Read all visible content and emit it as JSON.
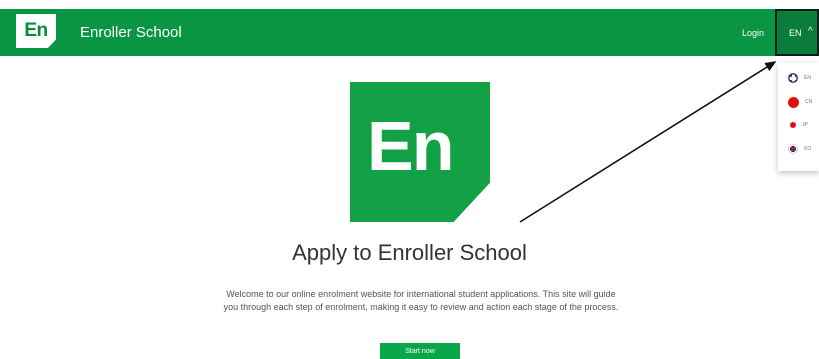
{
  "header": {
    "logo_text": "En",
    "brand": "Enroller School",
    "login": "Login",
    "lang_current": "EN",
    "lang_chevron": "^"
  },
  "language_menu": [
    {
      "code": "EN",
      "flag": "uk-flag-icon"
    },
    {
      "code": "CN",
      "flag": "china-flag-icon"
    },
    {
      "code": "JP",
      "flag": "japan-flag-icon"
    },
    {
      "code": "KO",
      "flag": "korea-flag-icon"
    }
  ],
  "hero": {
    "logo_text": "En",
    "title": "Apply to Enroller School",
    "intro": "Welcome to our online enrolment website for international student applications. This site will guide you through each step of enrolment, making it easy to review and action each stage of the process.",
    "cta": "Start now"
  },
  "colors": {
    "brand_green": "#0a9543",
    "logo_green": "#12a245",
    "button_green": "#0aa64a"
  }
}
